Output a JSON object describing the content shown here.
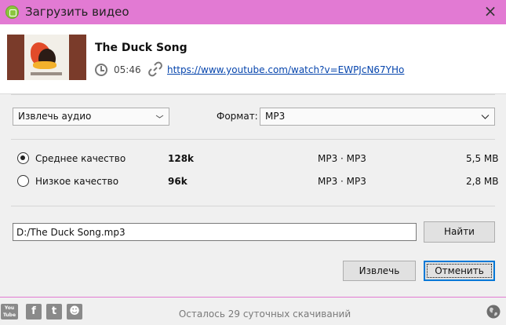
{
  "window": {
    "title": "Загрузить видео",
    "close_glyph": "×"
  },
  "video": {
    "title": "The Duck Song",
    "duration": "05:46",
    "url": "https://www.youtube.com/watch?v=EWPJcN67YHo"
  },
  "options": {
    "action_value": "Извлечь аудио",
    "format_label": "Формат:",
    "format_value": "MP3"
  },
  "quality": [
    {
      "label": "Среднее качество",
      "bitrate": "128k",
      "codec": "MP3 · MP3",
      "size": "5,5 MB",
      "selected": true
    },
    {
      "label": "Низкое качество",
      "bitrate": "96k",
      "codec": "MP3 · MP3",
      "size": "2,8 MB",
      "selected": false
    }
  ],
  "save": {
    "path": "D:/The Duck Song.mp3",
    "browse_label": "Найти"
  },
  "actions": {
    "extract_label": "Извлечь",
    "cancel_label": "Отменить"
  },
  "footer": {
    "status": "Осталось 29 суточных скачиваний",
    "social": [
      {
        "icon": "youtube-icon",
        "glyph": "You Tube"
      },
      {
        "icon": "facebook-icon",
        "glyph": "f"
      },
      {
        "icon": "twitter-icon",
        "glyph": "t"
      },
      {
        "icon": "reddit-icon",
        "glyph": "☻"
      }
    ]
  },
  "colors": {
    "titlebar": "#e27ad3",
    "link": "#0645ad",
    "default_button_border": "#0078d7",
    "app_icon": "#8cc63f"
  }
}
